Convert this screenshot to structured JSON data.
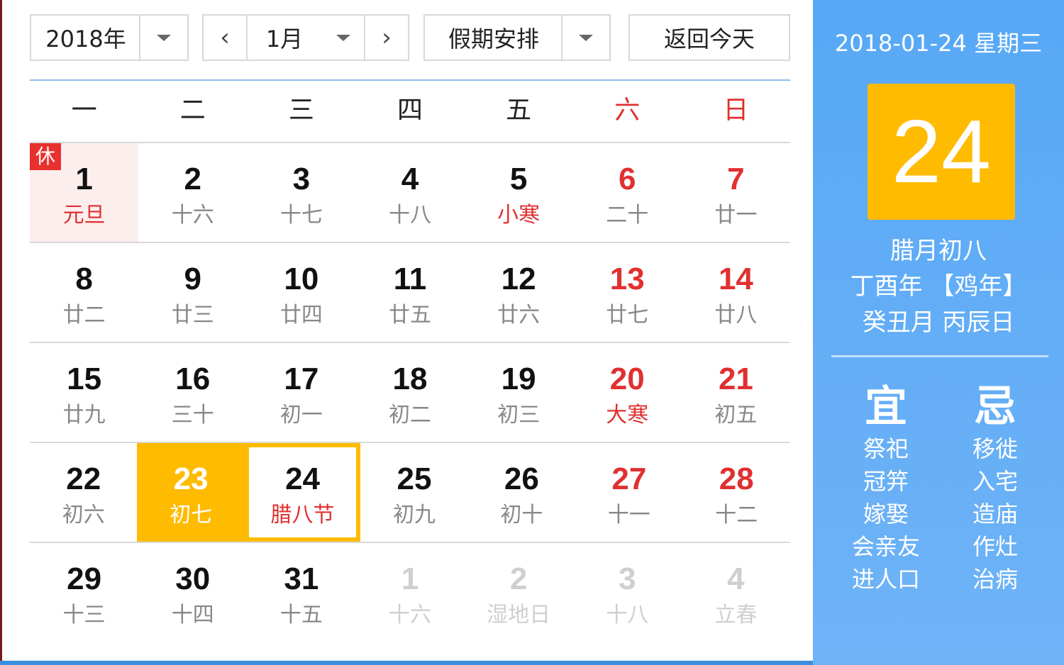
{
  "toolbar": {
    "year": "2018年",
    "month": "1月",
    "prev_icon": "‹",
    "next_icon": "›",
    "holiday": "假期安排",
    "today_button": "返回今天"
  },
  "weekdays": [
    "一",
    "二",
    "三",
    "四",
    "五",
    "六",
    "日"
  ],
  "weeks": [
    [
      {
        "day": "1",
        "lunar": "元旦",
        "festival": true,
        "holiday": true,
        "badge": "休"
      },
      {
        "day": "2",
        "lunar": "十六"
      },
      {
        "day": "3",
        "lunar": "十七"
      },
      {
        "day": "4",
        "lunar": "十八"
      },
      {
        "day": "5",
        "lunar": "小寒",
        "festival": true
      },
      {
        "day": "6",
        "lunar": "二十",
        "weekend": true
      },
      {
        "day": "7",
        "lunar": "廿一",
        "weekend": true
      }
    ],
    [
      {
        "day": "8",
        "lunar": "廿二"
      },
      {
        "day": "9",
        "lunar": "廿三"
      },
      {
        "day": "10",
        "lunar": "廿四"
      },
      {
        "day": "11",
        "lunar": "廿五"
      },
      {
        "day": "12",
        "lunar": "廿六"
      },
      {
        "day": "13",
        "lunar": "廿七",
        "weekend": true
      },
      {
        "day": "14",
        "lunar": "廿八",
        "weekend": true
      }
    ],
    [
      {
        "day": "15",
        "lunar": "廿九"
      },
      {
        "day": "16",
        "lunar": "三十"
      },
      {
        "day": "17",
        "lunar": "初一"
      },
      {
        "day": "18",
        "lunar": "初二"
      },
      {
        "day": "19",
        "lunar": "初三"
      },
      {
        "day": "20",
        "lunar": "大寒",
        "weekend": true,
        "festival": true
      },
      {
        "day": "21",
        "lunar": "初五",
        "weekend": true
      }
    ],
    [
      {
        "day": "22",
        "lunar": "初六"
      },
      {
        "day": "23",
        "lunar": "初七",
        "hover": true
      },
      {
        "day": "24",
        "lunar": "腊八节",
        "festival": true,
        "selected": true
      },
      {
        "day": "25",
        "lunar": "初九"
      },
      {
        "day": "26",
        "lunar": "初十"
      },
      {
        "day": "27",
        "lunar": "十一",
        "weekend": true
      },
      {
        "day": "28",
        "lunar": "十二",
        "weekend": true
      }
    ],
    [
      {
        "day": "29",
        "lunar": "十三"
      },
      {
        "day": "30",
        "lunar": "十四"
      },
      {
        "day": "31",
        "lunar": "十五"
      },
      {
        "day": "1",
        "lunar": "十六",
        "other": true
      },
      {
        "day": "2",
        "lunar": "湿地日",
        "other": true
      },
      {
        "day": "3",
        "lunar": "十八",
        "other": true
      },
      {
        "day": "4",
        "lunar": "立春",
        "other": true
      }
    ]
  ],
  "panel": {
    "date_line": "2018-01-24 星期三",
    "big_day": "24",
    "lunar_date": "腊月初八",
    "year_ganzhi": "丁酉年 【鸡年】",
    "month_day_ganzhi": "癸丑月 丙辰日",
    "yi_title": "宜",
    "ji_title": "忌",
    "yi": [
      "祭祀",
      "冠笄",
      "嫁娶",
      "会亲友",
      "进人口"
    ],
    "ji": [
      "移徙",
      "入宅",
      "造庙",
      "作灶",
      "治病"
    ]
  }
}
